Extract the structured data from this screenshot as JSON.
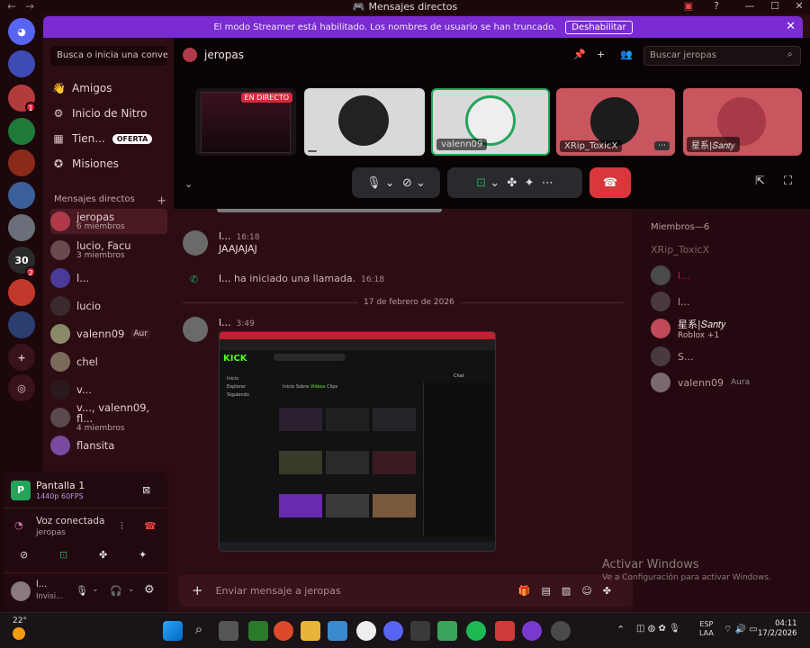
{
  "window": {
    "title": "Mensajes directos",
    "back": "←",
    "forward": "→"
  },
  "banner": {
    "text": "El modo Streamer está habilitado. Los nombres de usuario se han truncado.",
    "button": "Deshabilitar",
    "close": "✕"
  },
  "sidebar": {
    "search_placeholder": "Busca o inicia una conver...",
    "nav": [
      {
        "label": "Amigos"
      },
      {
        "label": "Inicio de Nitro"
      },
      {
        "label": "Tien...",
        "badge": "OFERTA"
      },
      {
        "label": "Misiones"
      }
    ],
    "dm_header": "Mensajes directos",
    "dm_add": "+",
    "dms": [
      {
        "name": "jeropas",
        "sub": "6 miembros"
      },
      {
        "name": "lucio, Facu",
        "sub": "3 miembros"
      },
      {
        "name": "l...",
        "sub": ""
      },
      {
        "name": "lucio",
        "sub": ""
      },
      {
        "name": "valenn09",
        "sub": "",
        "tag": "Aur"
      },
      {
        "name": "chel",
        "sub": ""
      },
      {
        "name": "v...",
        "sub": ""
      },
      {
        "name": "v..., valenn09, fl...",
        "sub": "4 miembros"
      },
      {
        "name": "flansita",
        "sub": ""
      }
    ]
  },
  "voice": {
    "screen_title": "Pantalla 1",
    "screen_sub": "1440p 60FPS",
    "status": "Voz conectada",
    "channel": "jeropas",
    "user": "l...",
    "user_status": "Invisi..."
  },
  "call": {
    "title": "jeropas",
    "search_placeholder": "Buscar jeropas",
    "live_badge": "EN DIRECTO",
    "tiles": [
      {
        "label": ""
      },
      {
        "label": ""
      },
      {
        "label": "valenn09"
      },
      {
        "label": "XRip_ToxicX"
      },
      {
        "label": "星系|𝑆𝑎𝑛𝑡𝑦"
      }
    ]
  },
  "chat": {
    "messages": [
      {
        "author": "l...",
        "time": "16:18",
        "text": "JAAJAJAJ"
      },
      {
        "author": "l...",
        "time": "16:18",
        "text": "ha iniciado una llamada."
      }
    ],
    "divider": "17 de febrero de 2026",
    "msg3": {
      "author": "l...",
      "time": "3:49"
    },
    "composer_placeholder": "Enviar mensaje a jeropas"
  },
  "screenshot_inner": {
    "brand": "KICK",
    "tabs": [
      "Inicio",
      "Sobre",
      "Videos",
      "Clips"
    ],
    "chat": "Chat",
    "side": [
      "Inicio",
      "Explorar",
      "Siguiendo"
    ]
  },
  "members": {
    "header": "Miembros—6",
    "list": [
      {
        "name": "XRip_ToxicX",
        "sub": ""
      },
      {
        "name": "l...",
        "sub": ""
      },
      {
        "name": "l...",
        "sub": ""
      },
      {
        "name": "星系|𝑆𝑎𝑛𝑡𝑦",
        "sub": "Roblox +1"
      },
      {
        "name": "S...",
        "sub": ""
      },
      {
        "name": "valenn09",
        "sub": "",
        "tag": "Aura"
      }
    ]
  },
  "watermark": {
    "line1": "Activar Windows",
    "line2": "Ve a Configuración para activar Windows."
  },
  "taskbar": {
    "temp": "22°",
    "lang1": "ESP",
    "lang2": "LAA",
    "time": "04:11",
    "date": "17/2/2026"
  },
  "colors": {
    "accent": "#7a2bd1",
    "hangup": "#da373c",
    "bg": "#2d0d14"
  }
}
